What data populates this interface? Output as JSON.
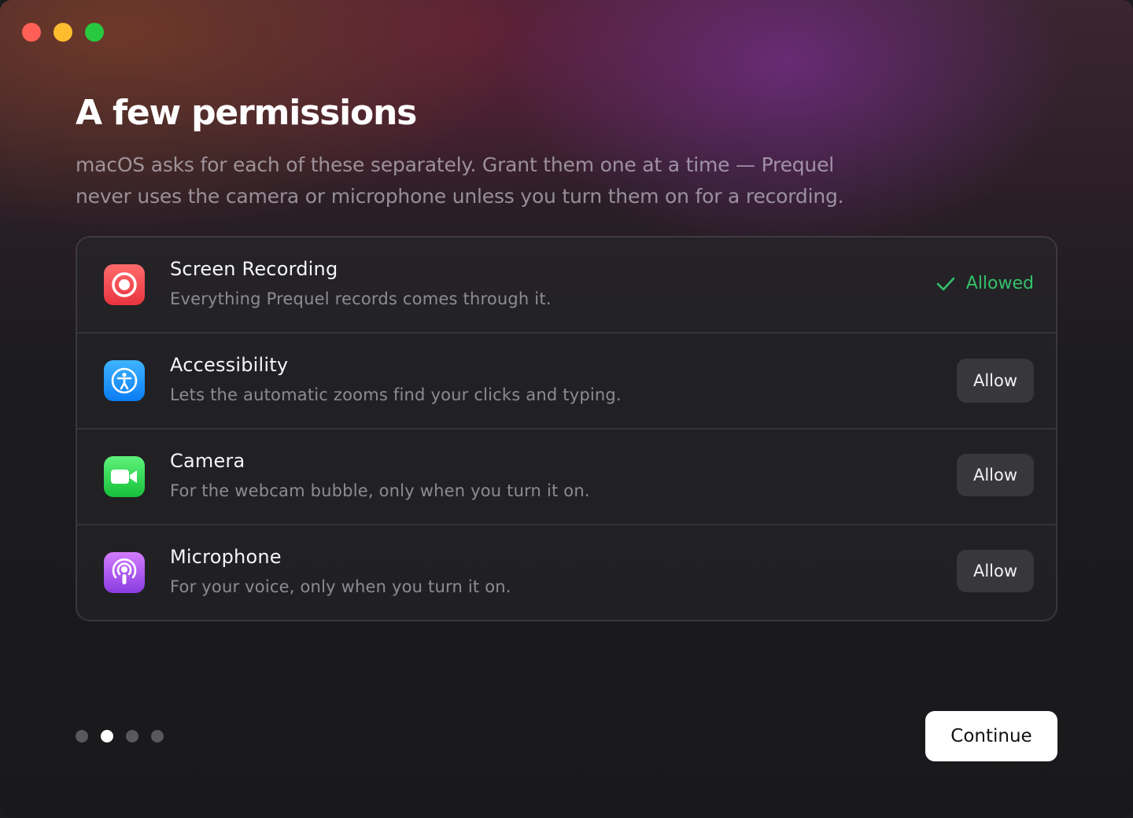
{
  "window": {
    "controls": [
      "close",
      "minimize",
      "zoom"
    ]
  },
  "header": {
    "title": "A few permissions",
    "subtitle": "macOS asks for each of these separately. Grant them one at a time — Prequel never uses the camera or microphone unless you turn them on for a recording."
  },
  "permissions": [
    {
      "icon": "screen-recording-icon",
      "icon_color": "#e8343f",
      "title": "Screen Recording",
      "description": "Everything Prequel records comes through it.",
      "status": "allowed",
      "status_label": "Allowed",
      "status_color": "#34c06b"
    },
    {
      "icon": "accessibility-icon",
      "icon_color": "#0a7cf2",
      "title": "Accessibility",
      "description": "Lets the automatic zooms find your clicks and typing.",
      "status": "pending",
      "button_label": "Allow"
    },
    {
      "icon": "camera-icon",
      "icon_color": "#16c03a",
      "title": "Camera",
      "description": "For the webcam bubble, only when you turn it on.",
      "status": "pending",
      "button_label": "Allow"
    },
    {
      "icon": "microphone-icon",
      "icon_color": "#8b3ce0",
      "title": "Microphone",
      "description": "For your voice, only when you turn it on.",
      "status": "pending",
      "button_label": "Allow"
    }
  ],
  "pagination": {
    "total": 4,
    "current": 2
  },
  "footer": {
    "continue_label": "Continue"
  }
}
